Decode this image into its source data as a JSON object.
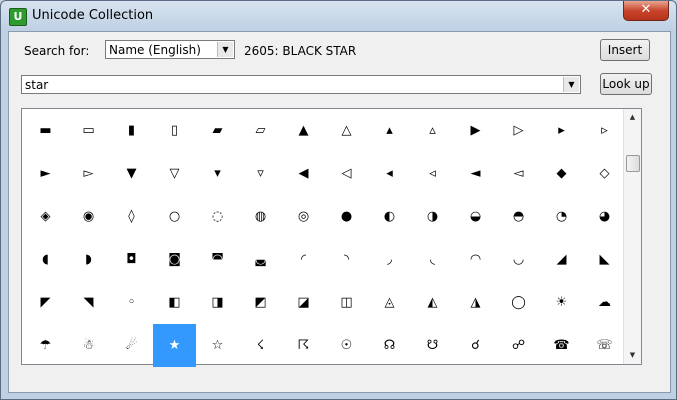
{
  "window": {
    "title": "Unicode Collection",
    "app_icon": "U",
    "close_glyph": "✕"
  },
  "search": {
    "label": "Search for:",
    "mode": "Name (English)",
    "query": "star"
  },
  "selection_info": "2605: BLACK STAR",
  "buttons": {
    "insert": "Insert",
    "lookup": "Look up"
  },
  "grid": {
    "rows": [
      [
        "▬",
        "▭",
        "▮",
        "▯",
        "▰",
        "▱",
        "▲",
        "△",
        "▴",
        "▵",
        "▶",
        "▷",
        "▸",
        "▹"
      ],
      [
        "►",
        "▻",
        "▼",
        "▽",
        "▾",
        "▿",
        "◀",
        "◁",
        "◂",
        "◃",
        "◄",
        "◅",
        "◆",
        "◇"
      ],
      [
        "◈",
        "◉",
        "◊",
        "○",
        "◌",
        "◍",
        "◎",
        "●",
        "◐",
        "◑",
        "◒",
        "◓",
        "◔",
        "◕"
      ],
      [
        "◖",
        "◗",
        "◘",
        "◙",
        "◚",
        "◛",
        "◜",
        "◝",
        "◞",
        "◟",
        "◠",
        "◡",
        "◢",
        "◣"
      ],
      [
        "◤",
        "◥",
        "◦",
        "◧",
        "◨",
        "◩",
        "◪",
        "◫",
        "◬",
        "◭",
        "◮",
        "◯",
        "☀",
        "☁"
      ],
      [
        "☂",
        "☃",
        "☄",
        "★",
        "☆",
        "☇",
        "☈",
        "☉",
        "☊",
        "☋",
        "☌",
        "☍",
        "☎",
        "☏"
      ]
    ],
    "selected": {
      "row": 5,
      "col": 3
    }
  },
  "colors": {
    "selection": "#3399ff"
  }
}
